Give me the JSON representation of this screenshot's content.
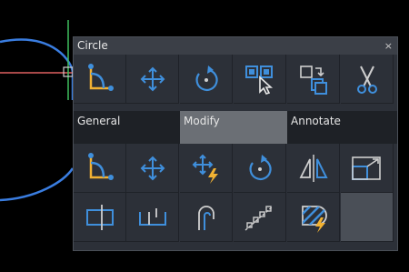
{
  "window": {
    "title": "Circle",
    "close_glyph": "×"
  },
  "tabs": [
    {
      "label": "General",
      "active": false
    },
    {
      "label": "Modify",
      "active": true
    },
    {
      "label": "Annotate",
      "active": false
    }
  ],
  "icons_row1": [
    "fillet-icon",
    "move-icon",
    "rotate-icon",
    "select-objects-icon",
    "copy-clip-icon",
    "scissors-icon"
  ],
  "icons_row2": [
    "fillet-icon",
    "move-icon",
    "move-lightning-icon",
    "rotate-icon",
    "mirror-icon",
    "scale-icon"
  ],
  "icons_row3": [
    "stretch-icon",
    "trim-icon",
    "offset-icon",
    "array-path-icon",
    "hatch-edit-icon",
    "empty"
  ],
  "colors": {
    "accent": "#3f8fdc",
    "highlight": "#f2b233",
    "background": "#000000",
    "panel": "#2c3038"
  }
}
